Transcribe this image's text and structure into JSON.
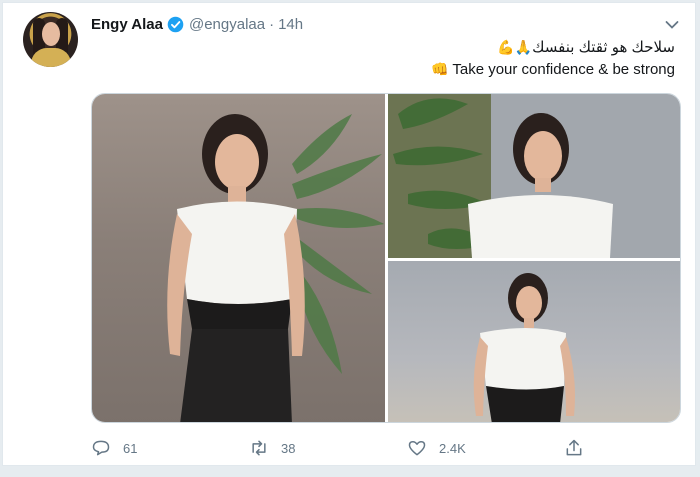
{
  "tweet": {
    "author": {
      "name": "Engy Alaa",
      "handle": "@engyalaa",
      "verified_icon": "verified-badge-icon",
      "avatar_icon": "profile-avatar"
    },
    "separator": "·",
    "time": "14h",
    "text_ar": "سلاحك هو ثقتك بنفسك",
    "text_ar_emojis": "🙏💪",
    "text_en": "Take your confidence & be strong",
    "text_en_emoji": "👊",
    "media": [
      {
        "icon": "photo-woman-full-body"
      },
      {
        "icon": "photo-woman-closeup"
      },
      {
        "icon": "photo-woman-standing"
      }
    ],
    "actions": {
      "reply_count": "61",
      "retweet_count": "38",
      "like_count": "2.4K"
    }
  },
  "colors": {
    "text": "#14171a",
    "secondary": "#657786",
    "verified": "#1da1f2",
    "border": "#e1e8ed"
  }
}
